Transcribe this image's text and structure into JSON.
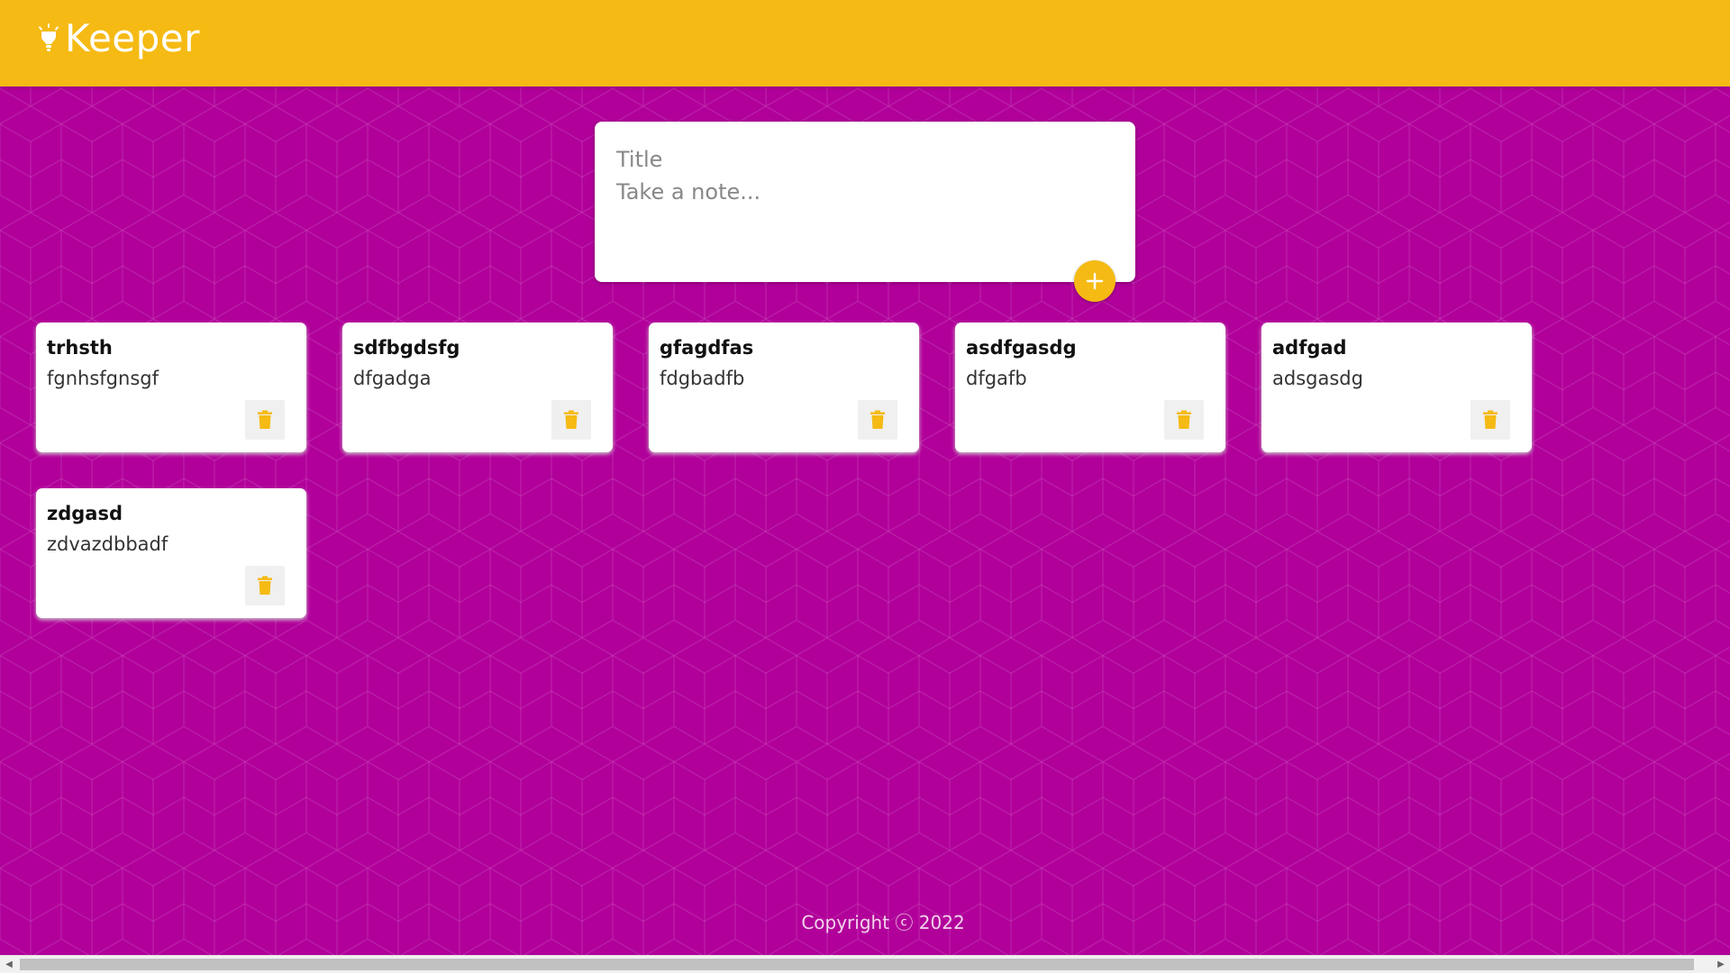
{
  "header": {
    "logo_text": "Keeper"
  },
  "create_area": {
    "title_placeholder": "Title",
    "content_placeholder": "Take a note...",
    "add_icon": "plus-icon"
  },
  "notes": [
    {
      "title": "trhsth",
      "content": "fgnhsfgnsgf"
    },
    {
      "title": "sdfbgdsfg",
      "content": "dfgadga"
    },
    {
      "title": "gfagdfas",
      "content": "fdgbadfb"
    },
    {
      "title": "asdfgasdg",
      "content": "dfgafb"
    },
    {
      "title": "adfgad",
      "content": "adsgasdg"
    },
    {
      "title": "zdgasd",
      "content": "zdvazdbbadf"
    }
  ],
  "delete_icon": "trash-icon",
  "footer": {
    "text": "Copyright ⓒ 2022"
  },
  "colors": {
    "accent": "#f5ba13",
    "background": "#b1009a",
    "card": "#ffffff"
  }
}
